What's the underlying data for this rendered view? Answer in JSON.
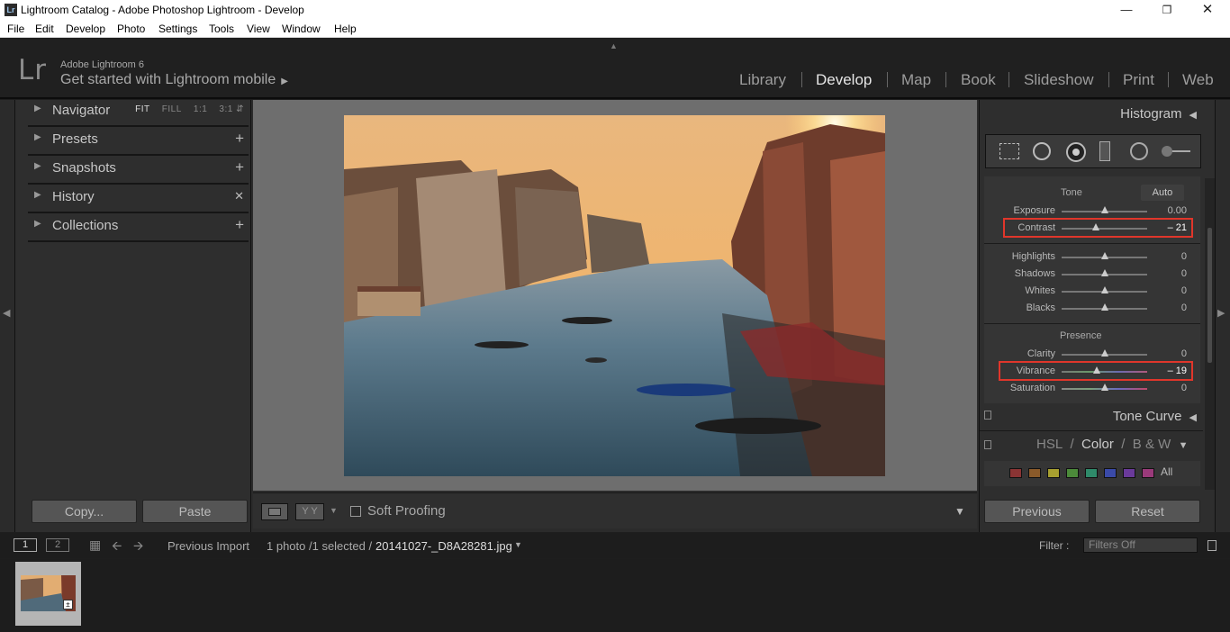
{
  "window": {
    "title": "Lightroom Catalog - Adobe Photoshop Lightroom - Develop",
    "icon": "Lr"
  },
  "menu": [
    "File",
    "Edit",
    "Develop",
    "Photo",
    "Settings",
    "Tools",
    "View",
    "Window",
    "Help"
  ],
  "identity": {
    "logo": "Lr",
    "version": "Adobe Lightroom 6",
    "mobile": "Get started with Lightroom mobile"
  },
  "modules": [
    "Library",
    "Develop",
    "Map",
    "Book",
    "Slideshow",
    "Print",
    "Web"
  ],
  "active_module": "Develop",
  "left_panel": {
    "navigator": {
      "label": "Navigator",
      "options": [
        "FIT",
        "FILL",
        "1:1",
        "3:1"
      ]
    },
    "presets": {
      "label": "Presets"
    },
    "snapshots": {
      "label": "Snapshots"
    },
    "history": {
      "label": "History"
    },
    "collections": {
      "label": "Collections"
    },
    "copy_label": "Copy...",
    "paste_label": "Paste"
  },
  "toolbar": {
    "soft_proofing": "Soft Proofing",
    "compare_label": "Y Y"
  },
  "right_panel": {
    "histogram": "Histogram",
    "tone_label": "Tone",
    "auto_label": "Auto",
    "sliders": {
      "exposure": {
        "label": "Exposure",
        "value": "0.00",
        "pos": 0.5
      },
      "contrast": {
        "label": "Contrast",
        "value": "– 21",
        "pos": 0.4
      },
      "highlights": {
        "label": "Highlights",
        "value": "0",
        "pos": 0.5
      },
      "shadows": {
        "label": "Shadows",
        "value": "0",
        "pos": 0.5
      },
      "whites": {
        "label": "Whites",
        "value": "0",
        "pos": 0.5
      },
      "blacks": {
        "label": "Blacks",
        "value": "0",
        "pos": 0.5
      },
      "clarity": {
        "label": "Clarity",
        "value": "0",
        "pos": 0.5
      },
      "vibrance": {
        "label": "Vibrance",
        "value": "– 19",
        "pos": 0.41
      },
      "saturation": {
        "label": "Saturation",
        "value": "0",
        "pos": 0.5
      }
    },
    "presence_label": "Presence",
    "tone_curve": "Tone Curve",
    "hsl": {
      "hsl": "HSL",
      "sep": "/",
      "color": "Color",
      "bw": "B & W"
    },
    "all_label": "All",
    "swatch_colors": [
      "#8a3434",
      "#8a5a2a",
      "#a8a030",
      "#4c8a3a",
      "#2f8a6a",
      "#3a4aa8",
      "#6a3a9a",
      "#9a3a7a"
    ],
    "previous_label": "Previous",
    "reset_label": "Reset"
  },
  "filmstrip": {
    "page1": "1",
    "page2": "2",
    "source": "Previous Import",
    "count": "1 photo /1 selected /",
    "filename": "20141027-_D8A28281.jpg",
    "filter_label": "Filter :",
    "filter_value": "Filters Off"
  }
}
